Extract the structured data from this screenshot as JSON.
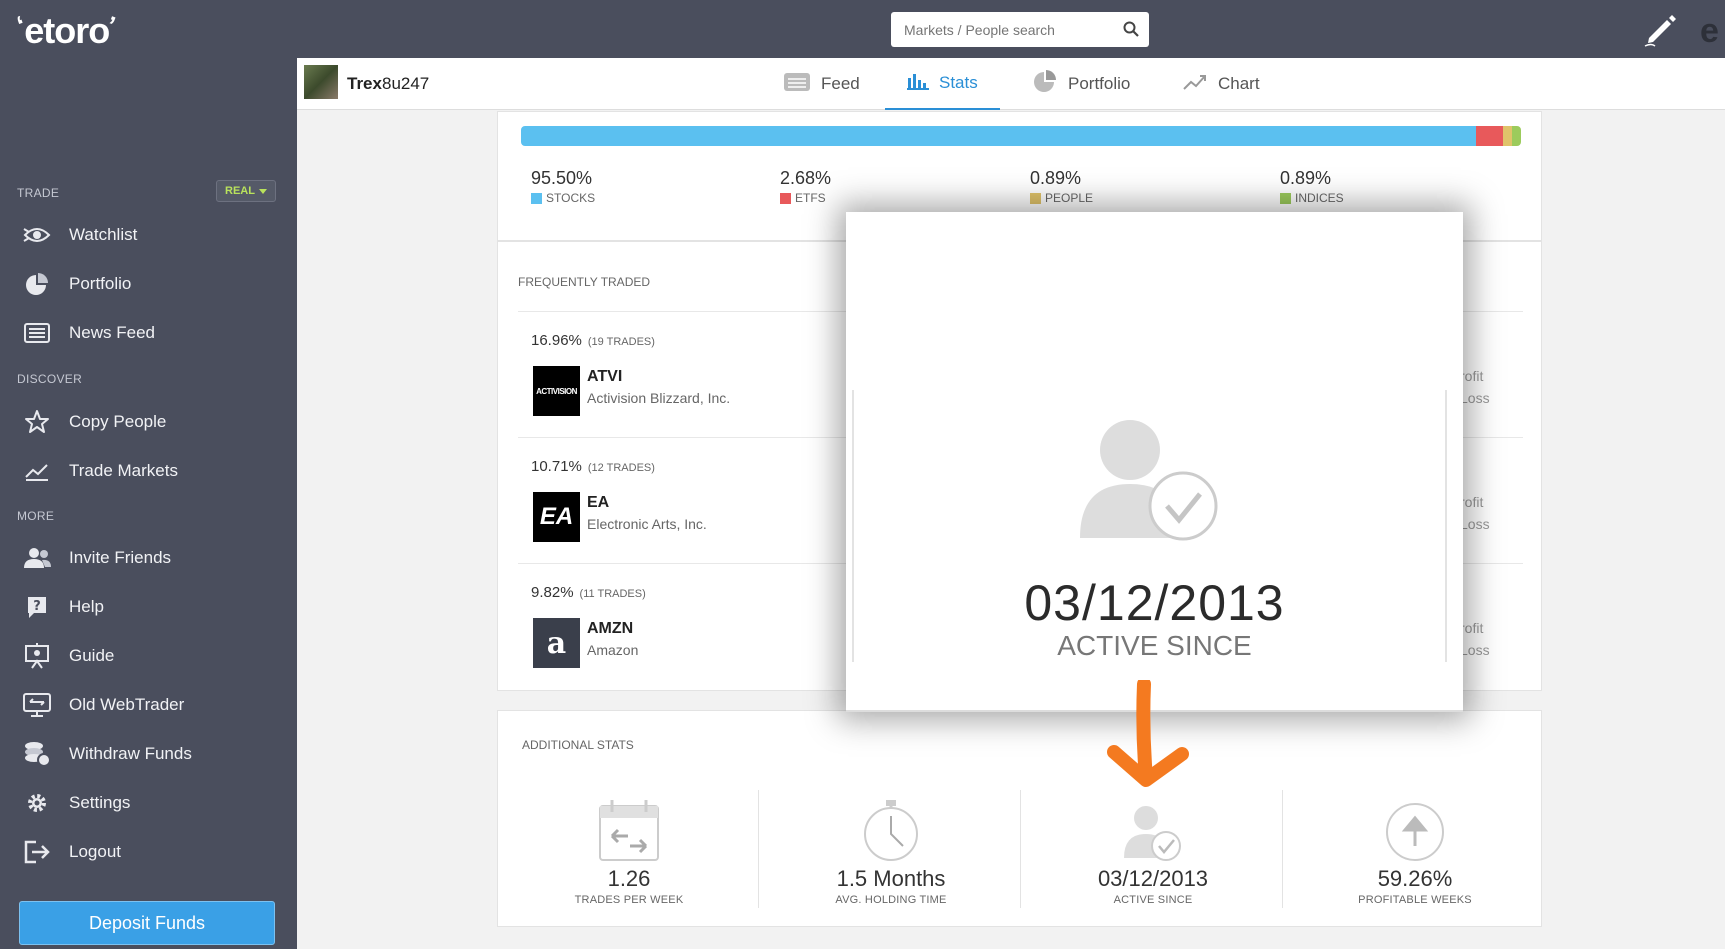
{
  "sidebar": {
    "logo": "etoro",
    "trade_label": "TRADE",
    "real_badge": "REAL",
    "discover_label": "DISCOVER",
    "more_label": "MORE",
    "items": [
      {
        "label": "Watchlist",
        "icon": "eye-icon"
      },
      {
        "label": "Portfolio",
        "icon": "pie-chart-icon"
      },
      {
        "label": "News Feed",
        "icon": "newspaper-icon"
      },
      {
        "label": "Copy People",
        "icon": "star-icon"
      },
      {
        "label": "Trade Markets",
        "icon": "trend-chart-icon"
      },
      {
        "label": "Invite Friends",
        "icon": "people-icon"
      },
      {
        "label": "Help",
        "icon": "help-icon"
      },
      {
        "label": "Guide",
        "icon": "presentation-icon"
      },
      {
        "label": "Old WebTrader",
        "icon": "monitor-icon"
      },
      {
        "label": "Withdraw Funds",
        "icon": "coins-icon"
      },
      {
        "label": "Settings",
        "icon": "gear-icon"
      },
      {
        "label": "Logout",
        "icon": "logout-icon"
      }
    ],
    "deposit_button": "Deposit Funds"
  },
  "topbar": {
    "search_placeholder": "Markets / People search",
    "edge_letter": "e"
  },
  "profile": {
    "username_bold": "Trex",
    "username_rest": "8u247"
  },
  "tabs": [
    {
      "label": "Feed",
      "active": false
    },
    {
      "label": "Stats",
      "active": true
    },
    {
      "label": "Portfolio",
      "active": false
    },
    {
      "label": "Chart",
      "active": false
    }
  ],
  "allocation": {
    "items": [
      {
        "pct": "95.50%",
        "name": "STOCKS",
        "color": "#5bc0f0",
        "share": 95.5
      },
      {
        "pct": "2.68%",
        "name": "ETFS",
        "color": "#e8595b",
        "share": 2.68
      },
      {
        "pct": "0.89%",
        "name": "PEOPLE",
        "color": "#e0c36a",
        "share": 0.89
      },
      {
        "pct": "0.89%",
        "name": "INDICES",
        "color": "#9ccb5c",
        "share": 0.89
      }
    ]
  },
  "frequently_traded": {
    "label": "FREQUENTLY TRADED",
    "rows": [
      {
        "pct": "16.96%",
        "trades": "(19 TRADES)",
        "symbol": "ATVI",
        "name": "Activision Blizzard, Inc.",
        "logo_text": "ACTIVISION",
        "pl1": "rofit",
        "pl2": "Loss"
      },
      {
        "pct": "10.71%",
        "trades": "(12 TRADES)",
        "symbol": "EA",
        "name": "Electronic Arts, Inc.",
        "logo_text": "EA",
        "pl1": "rofit",
        "pl2": "Loss"
      },
      {
        "pct": "9.82%",
        "trades": "(11 TRADES)",
        "symbol": "AMZN",
        "name": "Amazon",
        "logo_text": "a",
        "pl1": "rofit",
        "pl2": "Loss"
      }
    ]
  },
  "additional_stats": {
    "label": "ADDITIONAL STATS",
    "items": [
      {
        "value": "1.26",
        "label": "TRADES PER WEEK",
        "icon": "calendar-arrows-icon"
      },
      {
        "value": "1.5 Months",
        "label": "AVG. HOLDING TIME",
        "icon": "stopwatch-icon"
      },
      {
        "value": "03/12/2013",
        "label": "ACTIVE SINCE",
        "icon": "user-check-icon"
      },
      {
        "value": "59.26%",
        "label": "PROFITABLE WEEKS",
        "icon": "up-arrow-circle-icon"
      }
    ]
  },
  "popup": {
    "date": "03/12/2013",
    "label": "ACTIVE SINCE"
  },
  "colors": {
    "sidebar_bg": "#4a4e5d",
    "accent": "#2a8fd6",
    "deposit": "#3aa0e6",
    "arrow": "#f47a20"
  }
}
